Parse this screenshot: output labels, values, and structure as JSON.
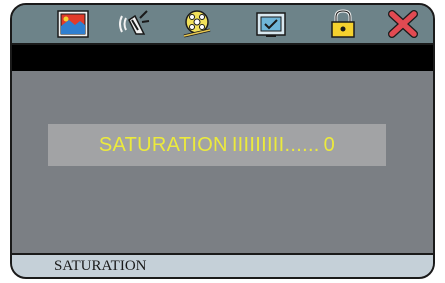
{
  "toolbar": {
    "icons": [
      "picture-icon",
      "sound-icon",
      "film-reel-icon",
      "tv-check-icon",
      "lock-icon",
      "close-icon"
    ]
  },
  "panel": {
    "label": "SATURATION",
    "bar_text": "IIIIIIIII......",
    "value": "0"
  },
  "status": {
    "text": "SATURATION"
  },
  "colors": {
    "toolbar": "#6d8389",
    "content": "#7b7f84",
    "panel": "#a2a3a5",
    "panel_text": "#ecea3c",
    "statusbar": "#c5d0d8"
  }
}
